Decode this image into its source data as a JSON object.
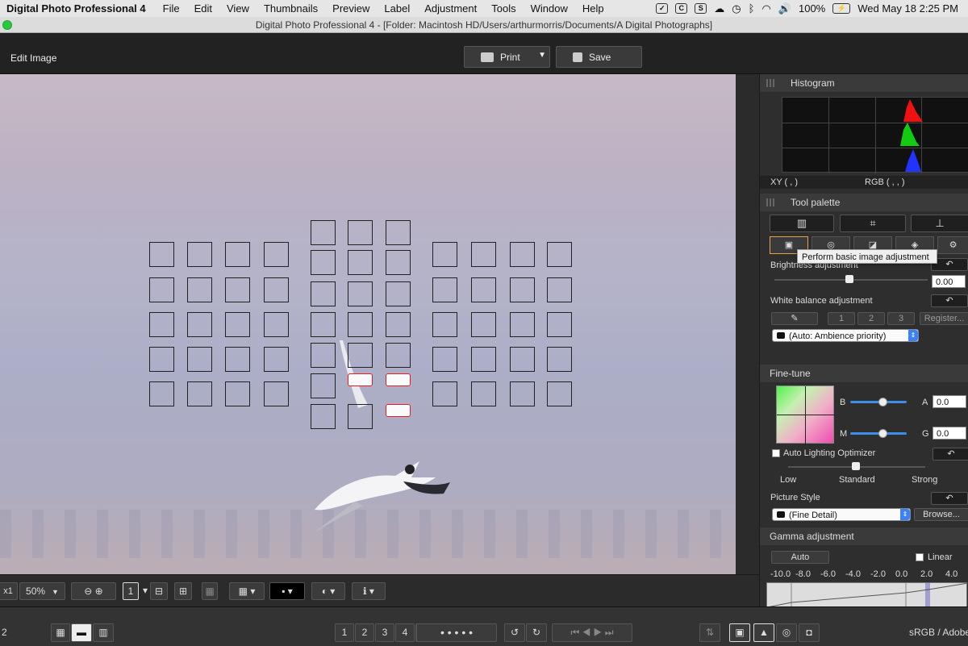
{
  "menubar": {
    "app": "Digital Photo Professional 4",
    "items": [
      "File",
      "Edit",
      "View",
      "Thumbnails",
      "Preview",
      "Label",
      "Adjustment",
      "Tools",
      "Window",
      "Help"
    ],
    "battery": "100%",
    "datetime": "Wed May 18  2:25 PM"
  },
  "window": {
    "title": "Digital Photo Professional 4 - [Folder: Macintosh HD/Users/arthurmorris/Documents/A Digital Photographs]"
  },
  "toolbar": {
    "mode": "Edit Image",
    "print": "Print",
    "save": "Save"
  },
  "histogram": {
    "title": "Histogram",
    "xy": "XY (           ,           )",
    "rgb": "RGB (          ,          ,          )"
  },
  "palette": {
    "title": "Tool palette",
    "tooltip": "Perform basic image adjustment",
    "brightness": {
      "label": "Brightness adjustment",
      "value": "0.00",
      "level": 0.5
    },
    "wb": {
      "label": "White balance adjustment",
      "b1": "1",
      "b2": "2",
      "b3": "3",
      "register": "Register...",
      "select": "(Auto: Ambience priority)"
    },
    "finetune": {
      "label": "Fine-tune",
      "b": "B",
      "a": "A",
      "m": "M",
      "g": "G",
      "ba_value": "0.0",
      "mg_value": "0.0"
    },
    "alo": {
      "label": "Auto Lighting Optimizer",
      "low": "Low",
      "standard": "Standard",
      "strong": "Strong"
    },
    "picstyle": {
      "label": "Picture Style",
      "select": "(Fine Detail)",
      "browse": "Browse..."
    },
    "gamma": {
      "label": "Gamma adjustment",
      "auto": "Auto",
      "linear": "Linear",
      "ticks": [
        "-10.0",
        "-8.0",
        "-6.0",
        "-4.0",
        "-2.0",
        "0.0",
        "2.0",
        "4.0"
      ]
    }
  },
  "bottom": {
    "zoom_prefix": "x1",
    "zoom": "50%"
  },
  "status": {
    "page": "2",
    "colorspace": "sRGB / Adobe",
    "ratings": [
      "1",
      "2",
      "3",
      "4",
      "5"
    ]
  }
}
